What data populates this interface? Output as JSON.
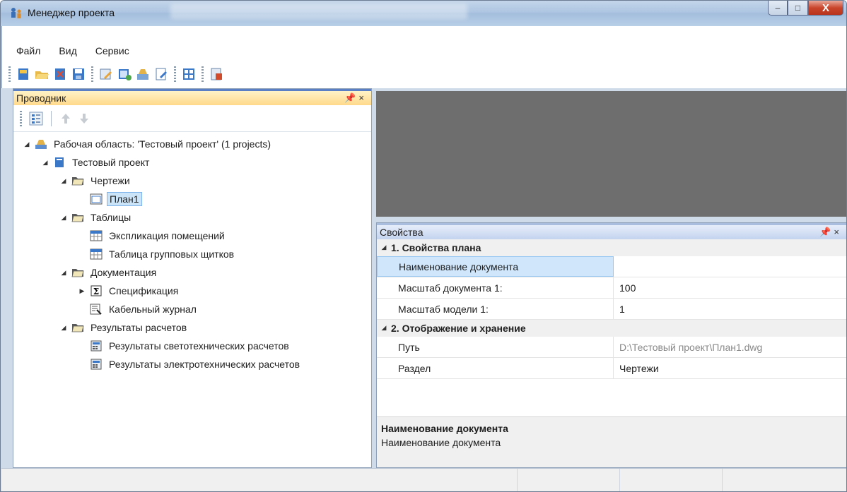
{
  "window": {
    "title": "Менеджер проекта",
    "close_glyph": "X",
    "min_glyph": "–",
    "max_glyph": "□"
  },
  "menu": [
    {
      "label": "Файл"
    },
    {
      "label": "Вид"
    },
    {
      "label": "Сервис"
    }
  ],
  "explorer": {
    "title": "Проводник",
    "pin_glyph": "ᵖ",
    "close_glyph": "×",
    "tree": [
      {
        "label": "Рабочая область: 'Тестовый проект' (1 projects)",
        "indent": 0,
        "arrow": "◢",
        "icon": "workspace-icon",
        "selected": false
      },
      {
        "label": "Тестовый проект",
        "indent": 1,
        "arrow": "◢",
        "icon": "project-icon",
        "selected": false
      },
      {
        "label": "Чертежи",
        "indent": 2,
        "arrow": "◢",
        "icon": "folder-icon",
        "selected": false
      },
      {
        "label": "План1",
        "indent": 3,
        "arrow": "",
        "icon": "drawing-icon",
        "selected": true
      },
      {
        "label": "Таблицы",
        "indent": 2,
        "arrow": "◢",
        "icon": "folder-icon",
        "selected": false
      },
      {
        "label": "Экспликация помещений",
        "indent": 3,
        "arrow": "",
        "icon": "table-icon",
        "selected": false
      },
      {
        "label": "Таблица групповых щитков",
        "indent": 3,
        "arrow": "",
        "icon": "table-icon",
        "selected": false
      },
      {
        "label": "Документация",
        "indent": 2,
        "arrow": "◢",
        "icon": "folder-icon",
        "selected": false
      },
      {
        "label": "Спецификация",
        "indent": 3,
        "arrow": "▶",
        "icon": "sum-icon",
        "selected": false
      },
      {
        "label": "Кабельный журнал",
        "indent": 3,
        "arrow": "",
        "icon": "cable-journal-icon",
        "selected": false
      },
      {
        "label": "Результаты расчетов",
        "indent": 2,
        "arrow": "◢",
        "icon": "folder-icon",
        "selected": false
      },
      {
        "label": "Результаты светотехнических расчетов",
        "indent": 3,
        "arrow": "",
        "icon": "calc-icon",
        "selected": false
      },
      {
        "label": "Результаты электротехнических расчетов",
        "indent": 3,
        "arrow": "",
        "icon": "calc-icon",
        "selected": false
      }
    ]
  },
  "properties": {
    "title": "Свойства",
    "pin_glyph": "ᵖ",
    "close_glyph": "×",
    "categories": [
      {
        "title": "1. Свойства плана",
        "arrow": "◢",
        "rows": [
          {
            "name": "Наименование документа",
            "value": "",
            "selected": true,
            "dim": false
          },
          {
            "name": "Масштаб документа 1:",
            "value": "100",
            "selected": false,
            "dim": false
          },
          {
            "name": "Масштаб модели 1:",
            "value": "1",
            "selected": false,
            "dim": false
          }
        ]
      },
      {
        "title": "2. Отображение и хранение",
        "arrow": "◢",
        "rows": [
          {
            "name": "Путь",
            "value": "D:\\Тестовый проект\\План1.dwg",
            "selected": false,
            "dim": true
          },
          {
            "name": "Раздел",
            "value": "Чертежи",
            "selected": false,
            "dim": false
          }
        ]
      }
    ],
    "description": {
      "title": "Наименование документа",
      "text": "Наименование документа"
    }
  },
  "colors": {
    "accent": "#5a7fc4",
    "explorer_header": "#ffd98a",
    "selection": "#cce4f7"
  }
}
